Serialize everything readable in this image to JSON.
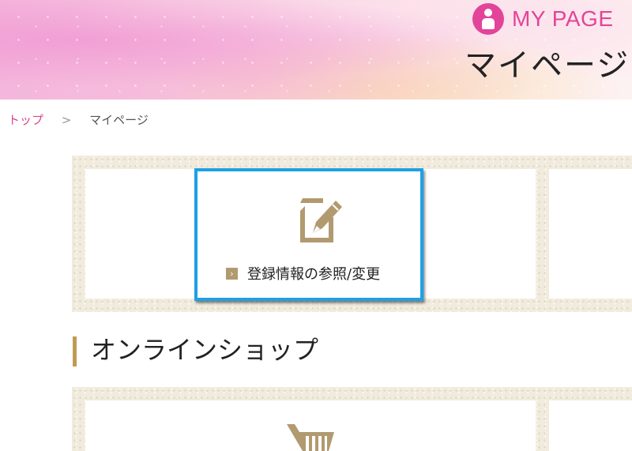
{
  "header": {
    "mypage_en": "MY PAGE",
    "mypage_jp": "マイページ",
    "accent_color": "#e2449a"
  },
  "breadcrumb": {
    "home": "トップ",
    "separator": ">",
    "current": "マイページ"
  },
  "menu": {
    "profile_link": "登録情報の参照/変更",
    "profile_icon": "edit-document-icon"
  },
  "sections": {
    "online_shop": "オンラインショップ",
    "shop_icon": "shopping-cart-icon"
  },
  "colors": {
    "focus_border": "#1da1e6",
    "gold": "#b29a70",
    "heading_bar": "#c19a52",
    "panel": "#f1ebdd"
  }
}
